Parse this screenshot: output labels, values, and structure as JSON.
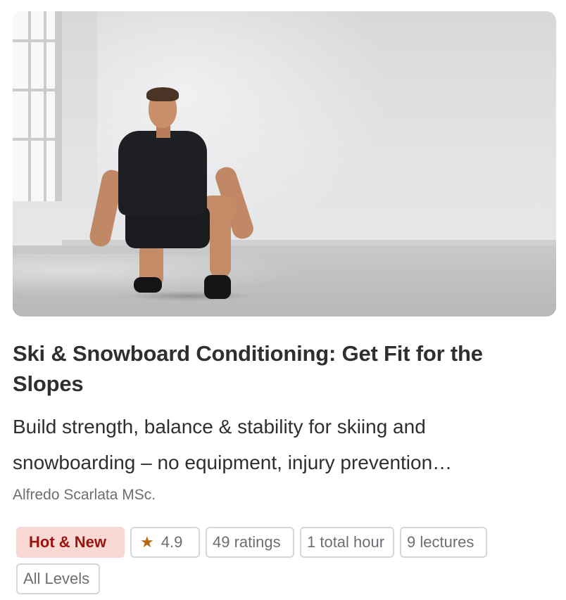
{
  "course": {
    "title": "Ski & Snowboard Conditioning: Get Fit for the Slopes",
    "headline": "Build strength, balance & stability for skiing and snowboarding – no equipment, injury prevention…",
    "instructor": "Alfredo Scarlata MSc.",
    "badge": "Hot & New",
    "rating": "4.9",
    "ratings_count": "49 ratings",
    "total_hours": "1 total hour",
    "lectures": "9 lectures",
    "level": "All Levels"
  },
  "icons": {
    "rating_icon": "star-icon"
  },
  "colors": {
    "badge_bg": "#fad8d4",
    "badge_text": "#98140e",
    "star": "#b4690e",
    "tag_border": "#d1d7dc",
    "title_text": "#2d2f31",
    "muted_text": "#6a6f73"
  }
}
